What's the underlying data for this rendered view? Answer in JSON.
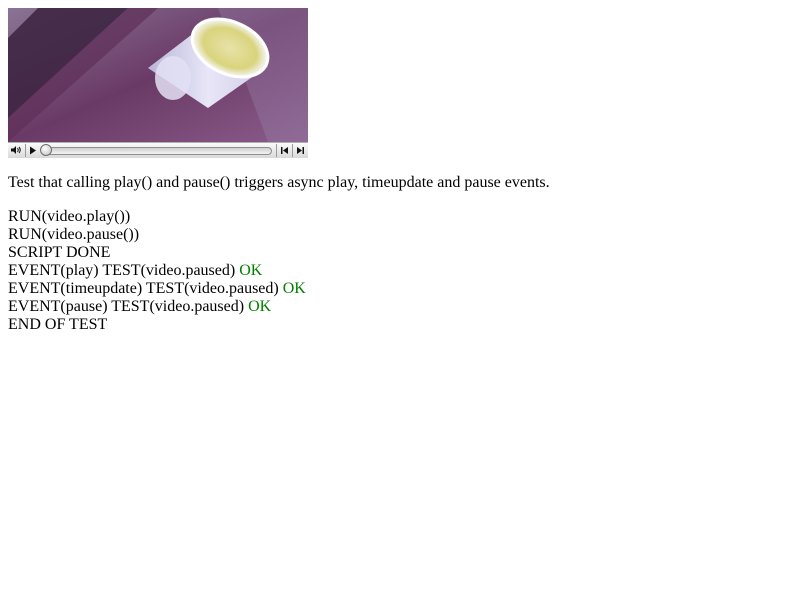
{
  "video": {
    "controls": {
      "volume_icon": "speaker-icon",
      "play_icon": "play-icon",
      "rewind_icon": "step-back-icon",
      "forward_icon": "step-forward-icon",
      "progress": 0
    }
  },
  "description": "Test that calling play() and pause() triggers async play, timeupdate and pause events.",
  "log": {
    "line1": "RUN(video.play())",
    "line2": "RUN(video.pause())",
    "line3": "SCRIPT DONE",
    "line4": {
      "text": "EVENT(play) TEST(video.paused)",
      "result": "OK"
    },
    "line5": {
      "text": "EVENT(timeupdate) TEST(video.paused)",
      "result": "OK"
    },
    "line6": {
      "text": "EVENT(pause) TEST(video.paused)",
      "result": "OK"
    },
    "line7": "END OF TEST"
  },
  "colors": {
    "ok": "#008000"
  }
}
